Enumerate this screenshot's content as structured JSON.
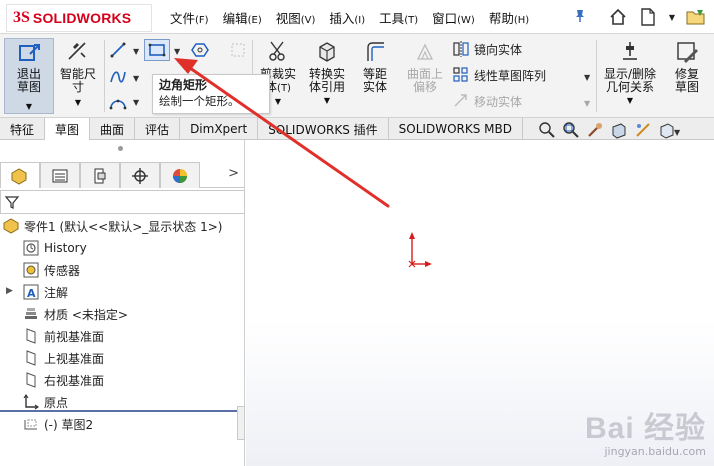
{
  "app": {
    "logo_prefix": "3S",
    "logo_text": "SOLIDWORKS"
  },
  "menu": [
    {
      "label": "文件",
      "accel": "(F)"
    },
    {
      "label": "编辑",
      "accel": "(E)"
    },
    {
      "label": "视图",
      "accel": "(V)"
    },
    {
      "label": "插入",
      "accel": "(I)"
    },
    {
      "label": "工具",
      "accel": "(T)"
    },
    {
      "label": "窗口",
      "accel": "(W)"
    },
    {
      "label": "帮助",
      "accel": "(H)"
    }
  ],
  "ribbon": {
    "exit_sketch": "退出草图",
    "smart_dim": "智能尺寸",
    "trim": "剪裁实体",
    "trim_accel": "(T)",
    "convert": "转换实体引用",
    "offset": "等距实体",
    "surface_offset": "曲面上偏移",
    "mirror": "镜向实体",
    "linear_pattern": "线性草图阵列",
    "move": "移动实体",
    "show_delete": "显示/删除几何关系",
    "repair": "修复草图"
  },
  "tooltip": {
    "title": "边角矩形",
    "desc": "绘制一个矩形。"
  },
  "tabs": [
    "特征",
    "草图",
    "曲面",
    "评估",
    "DimXpert",
    "SOLIDWORKS 插件",
    "SOLIDWORKS MBD"
  ],
  "tree": {
    "root": "零件1 (默认<<默认>_显示状态 1>)",
    "items": [
      "History",
      "传感器",
      "注解",
      "材质 <未指定>",
      "前视基准面",
      "上视基准面",
      "右视基准面",
      "原点",
      "(-) 草图2"
    ]
  },
  "watermark": {
    "brand": "Bai 经验",
    "url": "jingyan.baidu.com"
  },
  "colors": {
    "accent_red": "#d7001c",
    "arrow_red": "#e0302a",
    "exit_bg": "#cfd9e6"
  }
}
